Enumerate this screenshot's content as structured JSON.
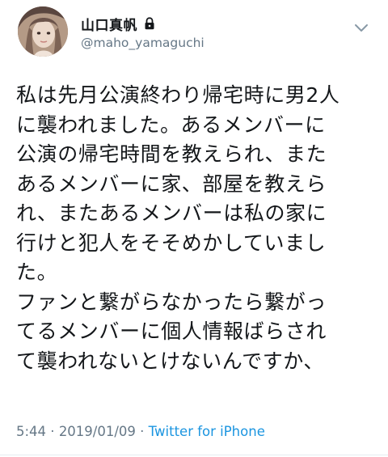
{
  "author": {
    "display_name": "山口真帆",
    "handle": "@maho_yamaguchi",
    "protected_icon": "lock-icon",
    "avatar": "avatar"
  },
  "menu": {
    "icon": "chevron-down-icon"
  },
  "tweet": {
    "lines": [
      "私は先月公演終わり帰宅時に男2人",
      "に襲われました。あるメンバーに",
      "公演の帰宅時間を教えられ、また",
      "あるメンバーに家、部屋を教えら",
      "れ、またあるメンバーは私の家に",
      "行けと犯人をそそめかしていまし",
      "た。",
      "ファンと繋がらなかったら繋がっ",
      "てるメンバーに個人情報ばらされ",
      "て襲われないとけないんですか、"
    ]
  },
  "meta": {
    "time": "5:44",
    "separator_1": " · ",
    "date": "2019/01/09",
    "separator_2": " · ",
    "source": "Twitter for iPhone"
  },
  "colors": {
    "text": "#14171a",
    "secondary": "#657786",
    "link": "#1b95e0"
  }
}
